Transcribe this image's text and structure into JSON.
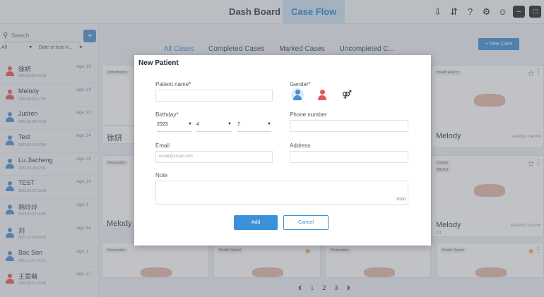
{
  "nav": {
    "tabs": [
      {
        "label": "Dash Board"
      },
      {
        "label": "Case Flow"
      }
    ]
  },
  "sidebar": {
    "search_placeholder": "Search",
    "filter_all": "All",
    "filter_sort": "Date of last vi...",
    "patients": [
      {
        "name": "徐妍",
        "date": "2022.04.04 10:38",
        "age": "Age: 10",
        "gender": "female"
      },
      {
        "name": "Melody",
        "date": "2022.08.25 17:08",
        "age": "Age: 23",
        "gender": "female"
      },
      {
        "name": "Judren",
        "date": "2022.08.09 16:03",
        "age": "Age: 23",
        "gender": "male"
      },
      {
        "name": "Test",
        "date": "2022.05.10 17:50",
        "age": "Age: 24",
        "gender": "male"
      },
      {
        "name": "Lu Jiacheng",
        "date": "2022.03.28 12:01",
        "age": "Age: 24",
        "gender": "male"
      },
      {
        "name": "TEST",
        "date": "2022.03.23 16:28",
        "age": "Age: 24",
        "gender": "male"
      },
      {
        "name": "韩玲玲",
        "date": "2022.02.24 15:05",
        "age": "Age: 1",
        "gender": "male"
      },
      {
        "name": "刘",
        "date": "2022.12.14 08:55",
        "age": "Age: 54",
        "gender": "male"
      },
      {
        "name": "Bac Son",
        "date": "2022.11.17 15:51",
        "age": "Age: 1",
        "gender": "male"
      },
      {
        "name": "王菜萌",
        "date": "2022.09.21 15:00",
        "age": "Age: 27",
        "gender": "female"
      }
    ]
  },
  "main": {
    "case_tabs": [
      "All Cases",
      "Completed Cases",
      "Marked Cases",
      "Uncompleted C..."
    ],
    "new_case_label": "+ New Case",
    "cards": [
      {
        "tag": "Orthodontics",
        "name": "",
        "date": ""
      },
      {
        "tag": "",
        "name": "徐妍",
        "date": ""
      },
      {
        "tag": "Restoration",
        "name": "",
        "date": ""
      },
      {
        "tag": "",
        "name": "Melody",
        "date": ""
      },
      {
        "tag": "Health Report",
        "name": "Melody",
        "date": "4/1/2022 1:48 PM"
      },
      {
        "tag": "Implant",
        "name": "Melody",
        "date": "3/16/2022 1:24 PM"
      },
      {
        "tag": "Restoration",
        "name": "",
        "date": ""
      },
      {
        "tag": "Health Report",
        "name": "",
        "date": ""
      },
      {
        "tag": "Restoration",
        "name": "",
        "date": ""
      },
      {
        "tag": "Health Report",
        "name": "",
        "date": ""
      }
    ],
    "implant_sub": "ABUNT",
    "melody_sub": "111",
    "pager": [
      "1",
      "2",
      "3"
    ]
  },
  "modal": {
    "title": "New Patient",
    "patient_name_label": "Patient name*",
    "gender_label": "Gender*",
    "birthday_label": "Birthday*",
    "birthday_year": "2023",
    "birthday_month": "4",
    "birthday_day": "7",
    "phone_label": "Phone number",
    "email_label": "Email",
    "email_placeholder": "email@email.com",
    "address_label": "Address",
    "note_label": "Note",
    "note_count": "0/100",
    "add_label": "Add",
    "cancel_label": "Cancel"
  },
  "colors": {
    "accent": "#3c92d8",
    "male": "#4a8fd0",
    "female": "#e05a52"
  }
}
